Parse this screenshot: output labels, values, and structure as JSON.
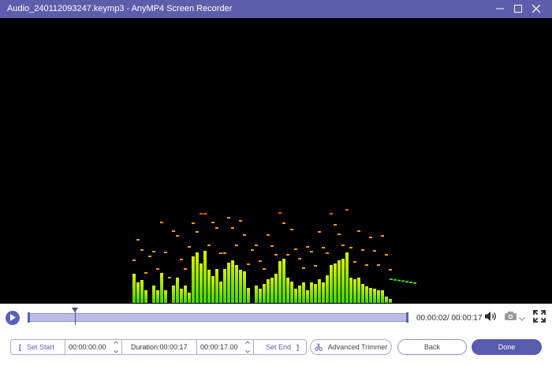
{
  "window": {
    "title": "Audio_240112093247.keymp3  -  AnyMP4 Screen Recorder",
    "minimize_icon": "minimize-icon",
    "maximize_icon": "maximize-icon",
    "close_icon": "close-icon"
  },
  "preview": {
    "bar_levels": [
      0.23,
      0.16,
      0.18,
      0.1,
      0,
      0.14,
      0.1,
      0.24,
      0.1,
      0,
      0.14,
      0.2,
      0.11,
      0.14,
      0.08,
      0.37,
      0.4,
      0.31,
      0.41,
      0.26,
      0.21,
      0.27,
      0.17,
      0.27,
      0.32,
      0.34,
      0.3,
      0.26,
      0.25,
      0.12,
      0,
      0.14,
      0.11,
      0.15,
      0.19,
      0.2,
      0.23,
      0.33,
      0.35,
      0.2,
      0.17,
      0.11,
      0.14,
      0.16,
      0.1,
      0.16,
      0.15,
      0.19,
      0.16,
      0.22,
      0.3,
      0.31,
      0.34,
      0.35,
      0.4,
      0.2,
      0.19,
      0.2,
      0.15,
      0.13,
      0.12,
      0.11,
      0.1,
      0.1,
      0.05,
      0.03
    ],
    "colors": {
      "bar_low": "#3ed800",
      "bar_high": "#d9f000",
      "peak_warm": "#ff9a00",
      "peak_hot": "#ff5a00"
    }
  },
  "player": {
    "play_icon": "play-icon",
    "progress_fraction": 0.125,
    "time_readout": "00:00:02/ 00:00:17",
    "volume_icon": "volume-icon",
    "camera_icon": "camera-icon",
    "dropdown_icon": "chevron-down-icon",
    "fullscreen_icon": "fullscreen-icon"
  },
  "clip": {
    "bracket_open": "[",
    "set_start_label": "Set Start",
    "start_value": "00:00:00.00",
    "duration_text": "Duration:00:00:17",
    "end_value": "00:00:17.00",
    "set_end_label": "Set End",
    "bracket_close": "]"
  },
  "actions": {
    "advanced_trimmer_label": "Advanced Trimmer",
    "trimmer_icon": "scissors-icon",
    "back_label": "Back",
    "done_label": "Done"
  }
}
